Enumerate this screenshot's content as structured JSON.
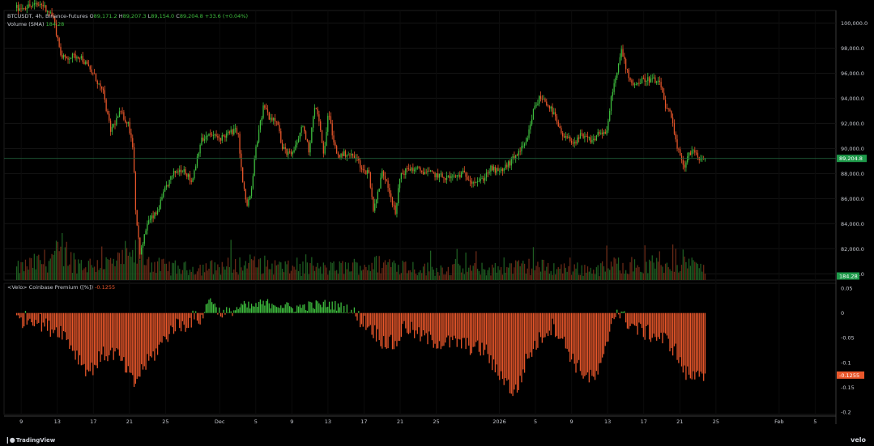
{
  "app": {
    "brand": "TradingView",
    "watermark": "velo"
  },
  "legend": {
    "symbol": "BTCUSDT, 4h, Binance-Futures",
    "open_label": "O",
    "open": "89,171.2",
    "high_label": "H",
    "high": "89,207.3",
    "low_label": "L",
    "low": "89,154.0",
    "close_label": "C",
    "close": "89,204.8",
    "change": "+33.6 (+0.04%)",
    "volume_label": "Volume (SMA)",
    "volume_value": "184.28",
    "indicator_label": "<Velo> Coinbase Premium ([%])",
    "indicator_value": "-0.1255"
  },
  "colors": {
    "up": "#3fbf3f",
    "down": "#e9572b",
    "background": "#000000",
    "grid": "#141414",
    "price_line": "#1f5f3a"
  },
  "chart_data": [
    {
      "type": "candlestick",
      "title": "BTCUSDT, 4h, Binance-Futures",
      "ylim": [
        79500,
        101000
      ],
      "y_ticks": [
        "100,000.0",
        "98,000.0",
        "96,000.0",
        "94,000.0",
        "92,000.0",
        "90,000.0",
        "88,000.0",
        "86,000.0",
        "84,000.0",
        "82,000.0",
        "80,000.0"
      ],
      "y_tick_values": [
        100000,
        98000,
        96000,
        94000,
        92000,
        90000,
        88000,
        86000,
        84000,
        82000,
        80000
      ],
      "current_price": 89204.8,
      "current_price_label": "89,204.8",
      "x_ticks": [
        "9",
        "13",
        "17",
        "21",
        "25",
        "Dec",
        "5",
        "9",
        "13",
        "17",
        "21",
        "25",
        "2026",
        "5",
        "9",
        "13",
        "17",
        "21",
        "25",
        "Feb",
        "5"
      ],
      "x_tick_days": [
        -22,
        -18,
        -14,
        -10,
        -6,
        0,
        4,
        8,
        12,
        16,
        20,
        24,
        31,
        35,
        39,
        43,
        47,
        51,
        55,
        62,
        66
      ],
      "first_bar_day": -22.5,
      "last_bar_day": 53.8,
      "close_anchors": [
        [
          -22.5,
          101200
        ],
        [
          -19.7,
          101500
        ],
        [
          -18.5,
          100600
        ],
        [
          -17.5,
          97200
        ],
        [
          -15.5,
          97400
        ],
        [
          -13.9,
          95800
        ],
        [
          -12.9,
          94400
        ],
        [
          -12.1,
          91400
        ],
        [
          -11.0,
          92900
        ],
        [
          -10.1,
          91900
        ],
        [
          -9.6,
          90100
        ],
        [
          -9.3,
          84900
        ],
        [
          -8.8,
          81500
        ],
        [
          -8.0,
          84100
        ],
        [
          -7.0,
          84800
        ],
        [
          -5.9,
          87000
        ],
        [
          -5.0,
          88100
        ],
        [
          -4.0,
          88400
        ],
        [
          -3.1,
          87300
        ],
        [
          -2.1,
          90600
        ],
        [
          -1.0,
          91100
        ],
        [
          0.0,
          90800
        ],
        [
          1.0,
          91200
        ],
        [
          2.0,
          91500
        ],
        [
          2.5,
          87500
        ],
        [
          3.0,
          85400
        ],
        [
          3.5,
          86500
        ],
        [
          4.0,
          90000
        ],
        [
          4.9,
          93500
        ],
        [
          5.5,
          92500
        ],
        [
          6.4,
          92300
        ],
        [
          6.9,
          90000
        ],
        [
          7.5,
          89700
        ],
        [
          8.0,
          89400
        ],
        [
          8.5,
          90300
        ],
        [
          9.2,
          91900
        ],
        [
          9.9,
          89800
        ],
        [
          10.5,
          93500
        ],
        [
          11.0,
          92300
        ],
        [
          11.5,
          89400
        ],
        [
          12.1,
          93100
        ],
        [
          12.5,
          90800
        ],
        [
          13.1,
          89400
        ],
        [
          14.1,
          89600
        ],
        [
          15.2,
          89200
        ],
        [
          16.0,
          88100
        ],
        [
          16.5,
          88300
        ],
        [
          17.0,
          85200
        ],
        [
          17.5,
          86300
        ],
        [
          18.0,
          88100
        ],
        [
          18.5,
          87500
        ],
        [
          19.0,
          86100
        ],
        [
          19.5,
          84700
        ],
        [
          20.0,
          87900
        ],
        [
          21.0,
          88400
        ],
        [
          21.9,
          88300
        ],
        [
          22.9,
          88100
        ],
        [
          23.9,
          87900
        ],
        [
          24.8,
          87700
        ],
        [
          25.9,
          87700
        ],
        [
          27.0,
          88000
        ],
        [
          28.0,
          87400
        ],
        [
          29.0,
          87400
        ],
        [
          30.0,
          88400
        ],
        [
          31.0,
          88100
        ],
        [
          32.1,
          88800
        ],
        [
          33.0,
          89600
        ],
        [
          34.0,
          90400
        ],
        [
          34.8,
          93100
        ],
        [
          35.5,
          94100
        ],
        [
          36.1,
          93800
        ],
        [
          37.0,
          92800
        ],
        [
          37.9,
          91000
        ],
        [
          38.7,
          90700
        ],
        [
          39.5,
          90500
        ],
        [
          40.0,
          91000
        ],
        [
          40.6,
          90800
        ],
        [
          41.4,
          90600
        ],
        [
          42.0,
          91300
        ],
        [
          42.9,
          91200
        ],
        [
          43.5,
          94600
        ],
        [
          44.1,
          96100
        ],
        [
          44.5,
          97900
        ],
        [
          45.0,
          96600
        ],
        [
          45.5,
          95400
        ],
        [
          46.1,
          95100
        ],
        [
          47.0,
          95500
        ],
        [
          48.0,
          95500
        ],
        [
          48.9,
          95000
        ],
        [
          49.5,
          93100
        ],
        [
          50.0,
          92700
        ],
        [
          50.5,
          90600
        ],
        [
          51.0,
          89400
        ],
        [
          51.5,
          88600
        ],
        [
          52.0,
          89600
        ],
        [
          52.5,
          89800
        ],
        [
          53.0,
          89200
        ],
        [
          53.8,
          89205
        ]
      ]
    },
    {
      "type": "bar",
      "title": "Volume (SMA)",
      "current_value_label": "184.28",
      "ylim": [
        0,
        260
      ],
      "shape_anchors": [
        [
          -22.5,
          90
        ],
        [
          -19.5,
          150
        ],
        [
          -18.0,
          200
        ],
        [
          -15.0,
          120
        ],
        [
          -12.0,
          130
        ],
        [
          -10.0,
          160
        ],
        [
          -9.0,
          220
        ],
        [
          -7.0,
          110
        ],
        [
          -4.0,
          90
        ],
        [
          -1.0,
          100
        ],
        [
          2.5,
          120
        ],
        [
          5.0,
          120
        ],
        [
          8.0,
          90
        ],
        [
          12.0,
          90
        ],
        [
          16.5,
          120
        ],
        [
          19.5,
          130
        ],
        [
          22.0,
          90
        ],
        [
          26.0,
          85
        ],
        [
          30.0,
          85
        ],
        [
          34.5,
          110
        ],
        [
          38.0,
          90
        ],
        [
          42.0,
          85
        ],
        [
          44.5,
          130
        ],
        [
          47.0,
          100
        ],
        [
          50.0,
          120
        ],
        [
          51.5,
          150
        ],
        [
          53.8,
          80
        ]
      ]
    },
    {
      "type": "bar",
      "title": "<Velo> Coinbase Premium ([%])",
      "current_value": -0.1255,
      "current_value_label": "-0.1255",
      "ylim": [
        -0.205,
        0.06
      ],
      "y_ticks": [
        "0.05",
        "0",
        "-0.05",
        "-0.1",
        "-0.15",
        "-0.2"
      ],
      "y_tick_values": [
        0.05,
        0,
        -0.05,
        -0.1,
        -0.15,
        -0.2
      ],
      "value_anchors": [
        [
          -22.5,
          -0.015
        ],
        [
          -20.5,
          -0.01
        ],
        [
          -19.0,
          -0.03
        ],
        [
          -17.5,
          -0.035
        ],
        [
          -16.0,
          -0.08
        ],
        [
          -14.5,
          -0.12
        ],
        [
          -13.0,
          -0.085
        ],
        [
          -11.5,
          -0.08
        ],
        [
          -10.5,
          -0.11
        ],
        [
          -9.5,
          -0.145
        ],
        [
          -8.5,
          -0.11
        ],
        [
          -7.5,
          -0.09
        ],
        [
          -6.0,
          -0.05
        ],
        [
          -5.0,
          -0.025
        ],
        [
          -4.0,
          -0.025
        ],
        [
          -3.0,
          -0.012
        ],
        [
          -2.0,
          -0.01
        ],
        [
          -1.5,
          0.012
        ],
        [
          -1.0,
          0.035
        ],
        [
          -0.5,
          0.012
        ],
        [
          0.5,
          -0.005
        ],
        [
          1.5,
          0.005
        ],
        [
          2.5,
          0.015
        ],
        [
          3.5,
          0.012
        ],
        [
          4.5,
          0.018
        ],
        [
          6.0,
          0.02
        ],
        [
          8.0,
          0.01
        ],
        [
          10.0,
          0.015
        ],
        [
          12.0,
          0.018
        ],
        [
          13.5,
          0.012
        ],
        [
          14.5,
          0.008
        ],
        [
          15.0,
          -0.005
        ],
        [
          16.5,
          -0.025
        ],
        [
          18.0,
          -0.055
        ],
        [
          19.5,
          -0.065
        ],
        [
          20.5,
          -0.025
        ],
        [
          22.0,
          -0.045
        ],
        [
          23.5,
          -0.055
        ],
        [
          24.5,
          -0.06
        ],
        [
          26.5,
          -0.06
        ],
        [
          28.0,
          -0.07
        ],
        [
          29.5,
          -0.075
        ],
        [
          30.5,
          -0.115
        ],
        [
          31.5,
          -0.13
        ],
        [
          32.5,
          -0.16
        ],
        [
          33.0,
          -0.155
        ],
        [
          34.0,
          -0.095
        ],
        [
          35.0,
          -0.065
        ],
        [
          36.0,
          -0.04
        ],
        [
          37.0,
          -0.025
        ],
        [
          38.0,
          -0.055
        ],
        [
          39.5,
          -0.105
        ],
        [
          40.5,
          -0.125
        ],
        [
          41.5,
          -0.135
        ],
        [
          42.5,
          -0.1
        ],
        [
          43.5,
          -0.01
        ],
        [
          44.0,
          0.005
        ],
        [
          45.0,
          -0.015
        ],
        [
          46.5,
          -0.035
        ],
        [
          48.0,
          -0.045
        ],
        [
          49.5,
          -0.055
        ],
        [
          50.5,
          -0.075
        ],
        [
          51.5,
          -0.12
        ],
        [
          52.5,
          -0.13
        ],
        [
          53.0,
          -0.11
        ],
        [
          53.8,
          -0.1255
        ]
      ]
    }
  ]
}
